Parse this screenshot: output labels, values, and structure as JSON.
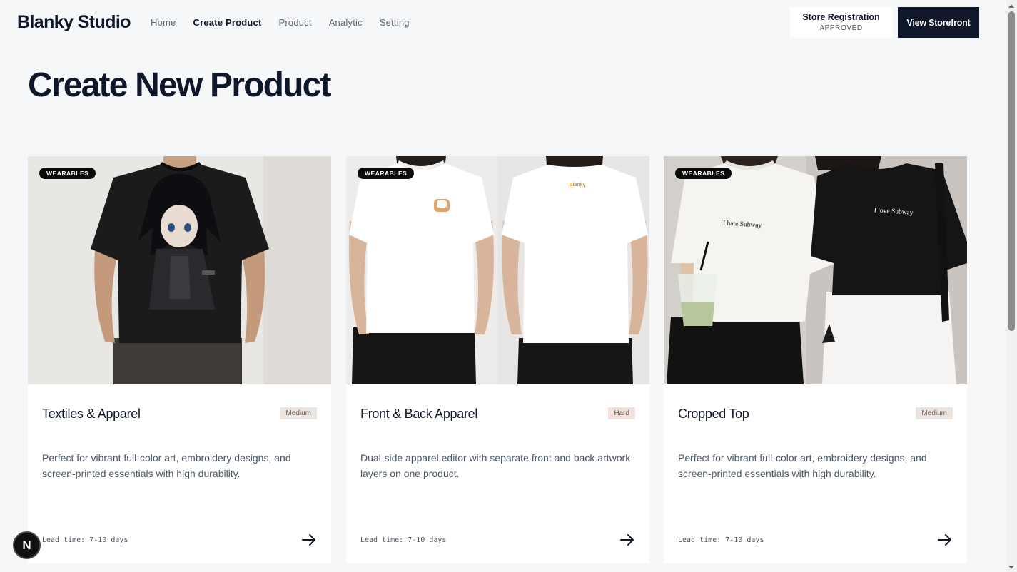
{
  "header": {
    "brand": "Blanky Studio",
    "nav": [
      {
        "label": "Home",
        "active": false
      },
      {
        "label": "Create Product",
        "active": true
      },
      {
        "label": "Product",
        "active": false
      },
      {
        "label": "Analytic",
        "active": false
      },
      {
        "label": "Setting",
        "active": false
      }
    ],
    "store_registration": {
      "title": "Store Registration",
      "status": "APPROVED"
    },
    "view_storefront": "View Storefront"
  },
  "page": {
    "title": "Create New Product"
  },
  "cards": [
    {
      "category": "WEARABLES",
      "title": "Textiles & Apparel",
      "difficulty": "Medium",
      "description": "Perfect for vibrant full-color art, embroidery designs, and screen-printed essentials with high durability.",
      "lead_time": "Lead time: 7-10 days"
    },
    {
      "category": "WEARABLES",
      "title": "Front & Back Apparel",
      "difficulty": "Hard",
      "description": "Dual-side apparel editor with separate front and back artwork layers on one product.",
      "lead_time": "Lead time: 7-10 days",
      "print_text": "Blanky"
    },
    {
      "category": "WEARABLES",
      "title": "Cropped Top",
      "difficulty": "Medium",
      "description": "Perfect for vibrant full-color art, embroidery designs, and screen-printed essentials with high durability.",
      "lead_time": "Lead time: 7-10 days",
      "print_text_left": "I hate Subway",
      "print_text_right": "I love Subway"
    }
  ],
  "dev_indicator": "N",
  "colors": {
    "primary": "#0f172a",
    "background": "#f6f7f9",
    "card": "#ffffff"
  }
}
